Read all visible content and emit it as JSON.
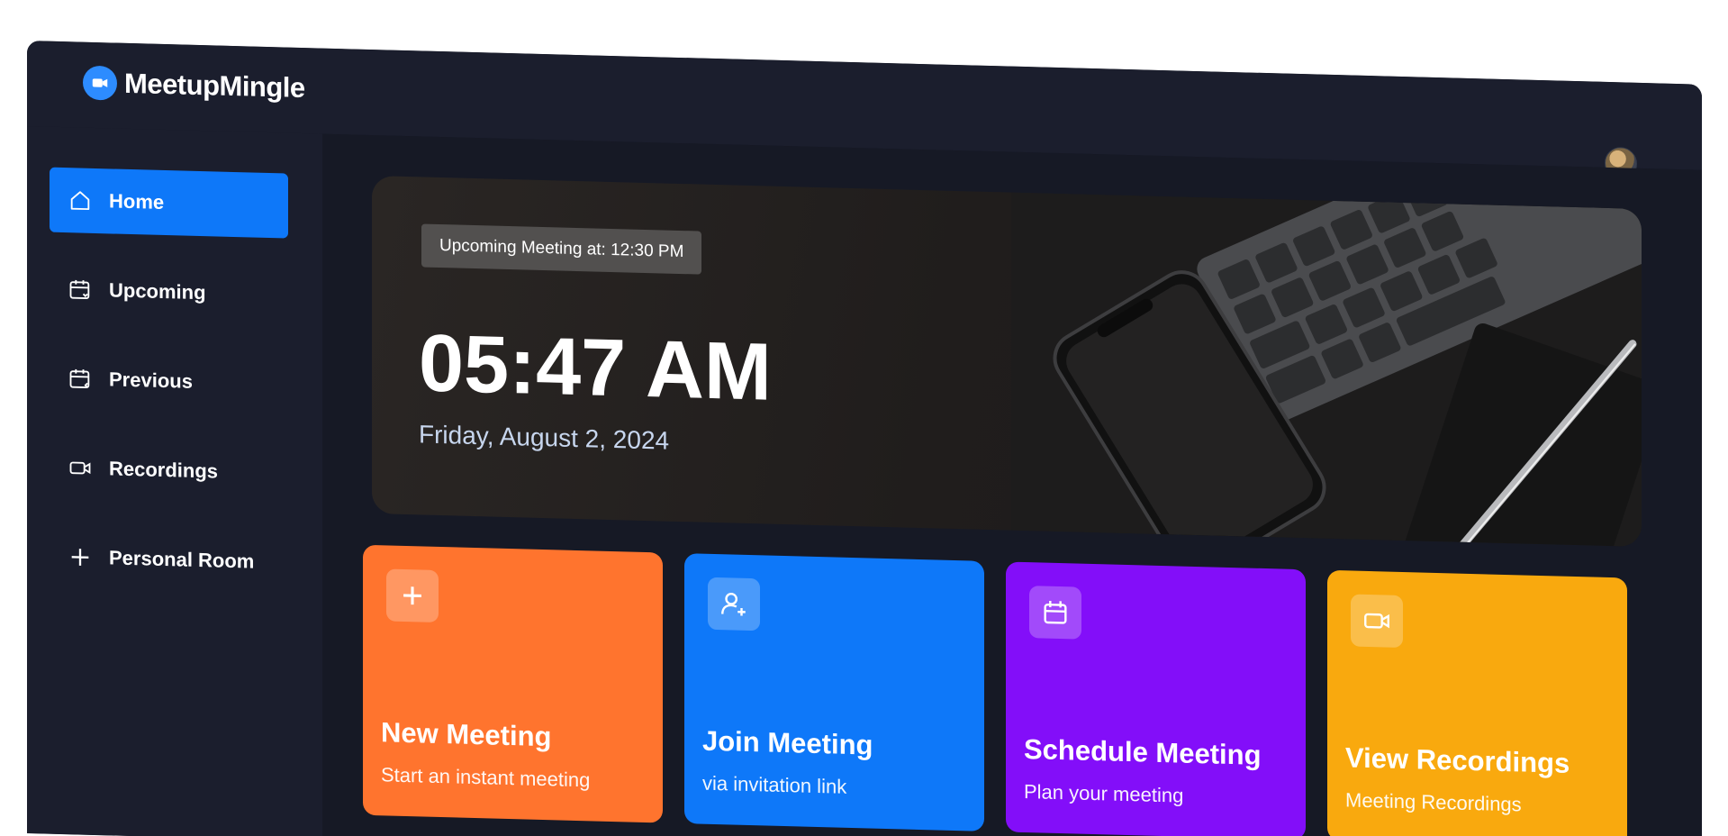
{
  "app": {
    "name": "MeetupMingle",
    "accent": "#0e78f9"
  },
  "sidebar": {
    "items": [
      {
        "label": "Home",
        "icon": "home-icon",
        "active": true
      },
      {
        "label": "Upcoming",
        "icon": "calendar-forward-icon"
      },
      {
        "label": "Previous",
        "icon": "calendar-back-icon"
      },
      {
        "label": "Recordings",
        "icon": "video-icon"
      },
      {
        "label": "Personal Room",
        "icon": "plus-icon"
      }
    ]
  },
  "hero": {
    "upcoming_label": "Upcoming Meeting at: 12:30 PM",
    "time": "05:47 AM",
    "date": "Friday, August 2, 2024"
  },
  "cards": [
    {
      "title": "New Meeting",
      "subtitle": "Start an instant meeting",
      "icon": "plus-icon",
      "color": "#ff742e"
    },
    {
      "title": "Join Meeting",
      "subtitle": "via invitation link",
      "icon": "add-user-icon",
      "color": "#0e78f9"
    },
    {
      "title": "Schedule Meeting",
      "subtitle": "Plan your meeting",
      "icon": "calendar-icon",
      "color": "#830ef9"
    },
    {
      "title": "View Recordings",
      "subtitle": "Meeting Recordings",
      "icon": "video-icon",
      "color": "#f9a90e"
    }
  ]
}
